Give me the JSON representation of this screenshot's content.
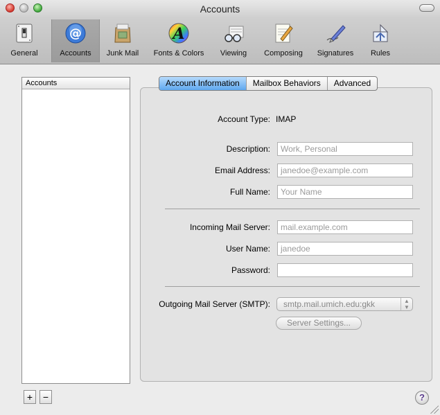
{
  "window": {
    "title": "Accounts"
  },
  "toolbar": {
    "items": [
      {
        "label": "General",
        "icon": "switch-icon"
      },
      {
        "label": "Accounts",
        "icon": "at-sign-icon"
      },
      {
        "label": "Junk Mail",
        "icon": "junk-mail-bag-icon"
      },
      {
        "label": "Fonts & Colors",
        "icon": "color-font-icon"
      },
      {
        "label": "Viewing",
        "icon": "glasses-icon"
      },
      {
        "label": "Composing",
        "icon": "pencil-paper-icon"
      },
      {
        "label": "Signatures",
        "icon": "signature-pen-icon"
      },
      {
        "label": "Rules",
        "icon": "rules-icon"
      }
    ],
    "selected": "Accounts"
  },
  "accounts_list": {
    "header": "Accounts",
    "items": [],
    "add_label": "+",
    "remove_label": "−"
  },
  "tabs": {
    "items": [
      "Account Information",
      "Mailbox Behaviors",
      "Advanced"
    ],
    "active": "Account Information"
  },
  "form": {
    "account_type_label": "Account Type:",
    "account_type_value": "IMAP",
    "description_label": "Description:",
    "description_placeholder": "Work, Personal",
    "email_label": "Email Address:",
    "email_placeholder": "janedoe@example.com",
    "fullname_label": "Full Name:",
    "fullname_placeholder": "Your Name",
    "incoming_label": "Incoming Mail Server:",
    "incoming_placeholder": "mail.example.com",
    "username_label": "User Name:",
    "username_placeholder": "janedoe",
    "password_label": "Password:",
    "password_value": "",
    "smtp_label": "Outgoing Mail Server (SMTP):",
    "smtp_value": "smtp.mail.umich.edu:gkk",
    "server_settings_label": "Server Settings..."
  },
  "help": {
    "label": "?"
  },
  "colors": {
    "tab_active": "#5fa8ef",
    "help_glyph": "#5a3b8c"
  }
}
